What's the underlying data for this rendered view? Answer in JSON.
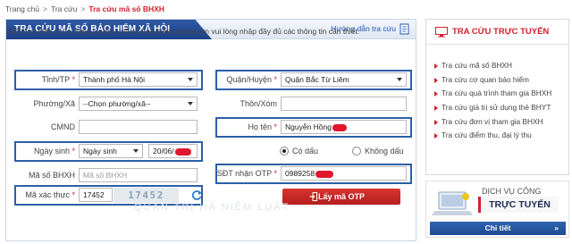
{
  "breadcrumb": {
    "home": "Trang chủ",
    "section": "Tra cứu",
    "current": "Tra cứu mã số BHXH",
    "separator": ">"
  },
  "panel": {
    "title": "TRA CỨU MÃ SỐ BẢO HIỂM XÃ HỘI",
    "guide_link": "Hướng dẫn tra cứu",
    "intro": "Để thực hiện chức năng tra cứu mã số bảo hiểm xã hội, xin vui lòng nhập đầy đủ các thông tin cần thiết."
  },
  "form": {
    "province": {
      "label": "Tỉnh/TP",
      "required": "*",
      "value": "Thành phố Hà Nội"
    },
    "district": {
      "label": "Quận/Huyện",
      "required": "*",
      "value": "Quận Bắc Từ Liêm"
    },
    "ward": {
      "label": "Phường/Xã",
      "value": "--Chọn phường/xã--"
    },
    "hamlet": {
      "label": "Thôn/Xóm",
      "value": ""
    },
    "id_number": {
      "label": "CMND",
      "value": ""
    },
    "full_name": {
      "label": "Họ tên",
      "required": "*",
      "value": "Nguyễn Hồng"
    },
    "dob": {
      "label": "Ngày sinh",
      "required": "*",
      "type_value": "Ngày sinh",
      "date_value": "20/06/"
    },
    "accent": {
      "with": "Có dấu",
      "without": "Không dấu",
      "selected": "with"
    },
    "insurance_code": {
      "label": "Mã số BHXH",
      "placeholder": "Mã số BHXH"
    },
    "otp_phone": {
      "label": "SĐT nhận OTP",
      "required": "*",
      "value": "0989258"
    },
    "captcha": {
      "label": "Mã xác thực",
      "required": "*",
      "value": "17452",
      "image_text": "17452"
    },
    "otp_button": "Lấy mã OTP"
  },
  "watermark": "QUẢN TRỊ HÀ NIỆM LUẬT",
  "sidebar": {
    "title": "TRA CỨU TRỰC TUYẾN",
    "items": [
      "Tra cứu mã số BHXH",
      "Tra cứu cơ quan bảo hiểm",
      "Tra cứu quá trình tham gia BHXH",
      "Tra cứu giá trị sử dụng thẻ BHYT",
      "Tra cứu đơn vị tham gia BHXH",
      "Tra cứu điểm thu, đại lý thu"
    ]
  },
  "banner": {
    "top_text": "DỊCH VỤ CÔNG",
    "main_text": "TRỰC TUYẾN",
    "button": "Chi tiết",
    "button_arrow": "»"
  },
  "colors": {
    "brand_blue": "#1b3f84",
    "highlight_blue": "#2d5fa8",
    "accent_red": "#d21f2b",
    "redaction_red": "#e0172f"
  }
}
